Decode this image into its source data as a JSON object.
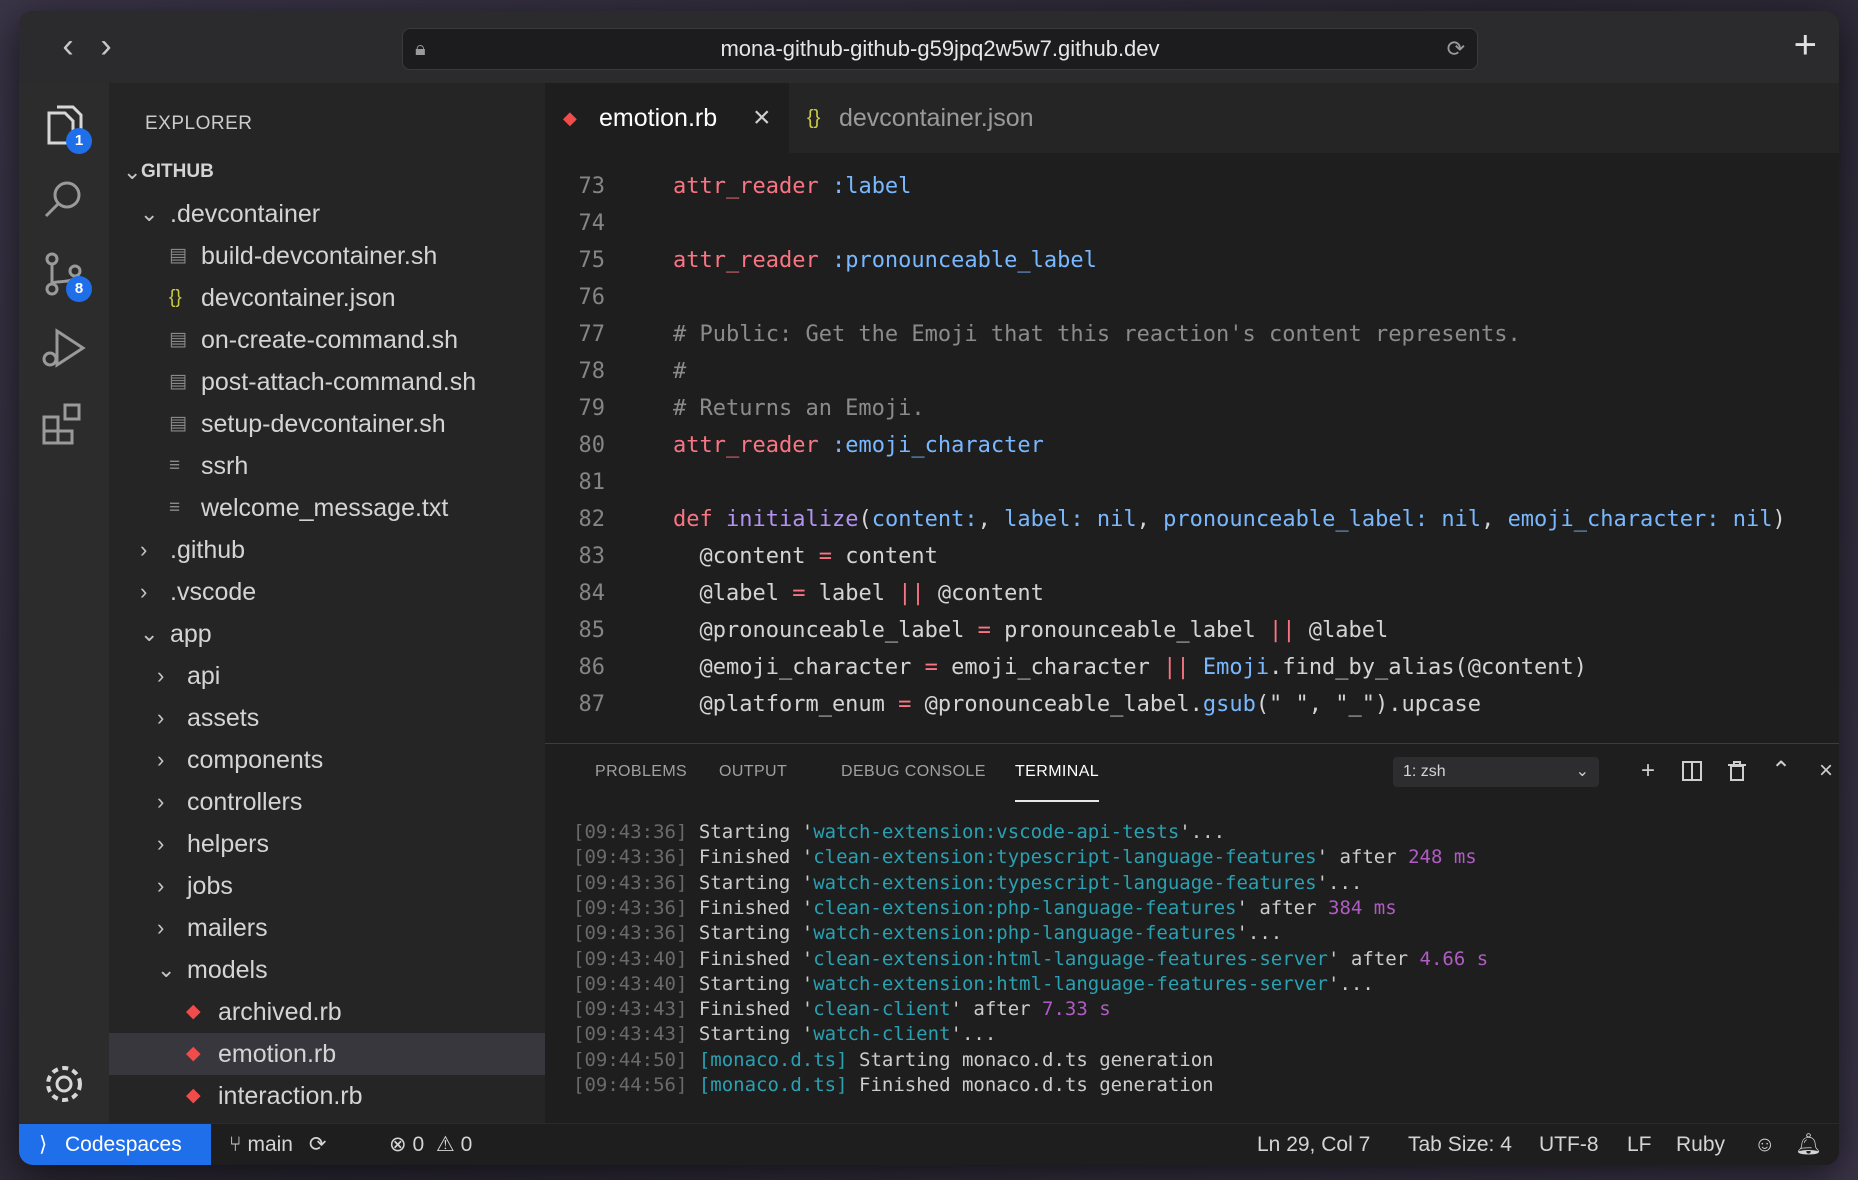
{
  "browser": {
    "url": "mona-github-github-g59jpq2w5w7.github.dev",
    "back": "‹",
    "forward": "›",
    "new_tab": "+"
  },
  "activity_bar": {
    "explorer_badge": "1",
    "scm_badge": "8"
  },
  "sidebar": {
    "title": "EXPLORER",
    "items": [
      {
        "label": "GITHUB",
        "chev": "⌄",
        "icon": ""
      },
      {
        "label": ".devcontainer",
        "chev": "⌄",
        "icon": ""
      },
      {
        "label": "build-devcontainer.sh",
        "chev": "",
        "icon": "▤"
      },
      {
        "label": "devcontainer.json",
        "chev": "",
        "icon": "{}"
      },
      {
        "label": "on-create-command.sh",
        "chev": "",
        "icon": "▤"
      },
      {
        "label": "post-attach-command.sh",
        "chev": "",
        "icon": "▤"
      },
      {
        "label": "setup-devcontainer.sh",
        "chev": "",
        "icon": "▤"
      },
      {
        "label": "ssrh",
        "chev": "",
        "icon": "≡"
      },
      {
        "label": "welcome_message.txt",
        "chev": "",
        "icon": "≡"
      },
      {
        "label": ".github",
        "chev": "›",
        "icon": ""
      },
      {
        "label": ".vscode",
        "chev": "›",
        "icon": ""
      },
      {
        "label": "app",
        "chev": "⌄",
        "icon": ""
      },
      {
        "label": "api",
        "chev": "›",
        "icon": ""
      },
      {
        "label": "assets",
        "chev": "›",
        "icon": ""
      },
      {
        "label": "components",
        "chev": "›",
        "icon": ""
      },
      {
        "label": "controllers",
        "chev": "›",
        "icon": ""
      },
      {
        "label": "helpers",
        "chev": "›",
        "icon": ""
      },
      {
        "label": "jobs",
        "chev": "›",
        "icon": ""
      },
      {
        "label": "mailers",
        "chev": "›",
        "icon": ""
      },
      {
        "label": "models",
        "chev": "⌄",
        "icon": ""
      },
      {
        "label": "archived.rb",
        "chev": "",
        "icon": "◆"
      },
      {
        "label": "emotion.rb",
        "chev": "",
        "icon": "◆"
      },
      {
        "label": "interaction.rb",
        "chev": "",
        "icon": "◆"
      }
    ]
  },
  "editor": {
    "tabs": [
      {
        "label": "emotion.rb",
        "icon": "◆",
        "close": "×"
      },
      {
        "label": "devcontainer.json",
        "icon": "{}"
      }
    ],
    "lines": [
      {
        "n": "73",
        "t": "attr_reader :label"
      },
      {
        "n": "74",
        "t": ""
      },
      {
        "n": "75",
        "t": "attr_reader :pronounceable_label"
      },
      {
        "n": "76",
        "t": ""
      },
      {
        "n": "77",
        "t": "# Public: Get the Emoji that this reaction's content represents."
      },
      {
        "n": "78",
        "t": "#"
      },
      {
        "n": "79",
        "t": "# Returns an Emoji."
      },
      {
        "n": "80",
        "t": "attr_reader :emoji_character"
      },
      {
        "n": "81",
        "t": ""
      },
      {
        "n": "82",
        "t": "def initialize(content:, label: nil, pronounceable_label: nil, emoji_character: nil)"
      },
      {
        "n": "83",
        "t": "  @content = content"
      },
      {
        "n": "84",
        "t": "  @label = label || @content"
      },
      {
        "n": "85",
        "t": "  @pronounceable_label = pronounceable_label || @label"
      },
      {
        "n": "86",
        "t": "  @emoji_character = emoji_character || Emoji.find_by_alias(@content)"
      },
      {
        "n": "87",
        "t": "  @platform_enum = @pronounceable_label.gsub(\" \", \"_\").upcase"
      }
    ]
  },
  "panel": {
    "tabs": [
      "PROBLEMS",
      "OUTPUT",
      "DEBUG CONSOLE",
      "TERMINAL"
    ],
    "terminal_select": "1: zsh",
    "lines": [
      {
        "time": "[09:43:36]",
        "pre": " Starting '",
        "task": "watch-extension:vscode-api-tests",
        "post": "'...",
        "dur": ""
      },
      {
        "time": "[09:43:36]",
        "pre": " Finished '",
        "task": "clean-extension:typescript-language-features",
        "post": "' after ",
        "dur": "248 ms"
      },
      {
        "time": "[09:43:36]",
        "pre": " Starting '",
        "task": "watch-extension:typescript-language-features",
        "post": "'...",
        "dur": ""
      },
      {
        "time": "[09:43:36]",
        "pre": " Finished '",
        "task": "clean-extension:php-language-features",
        "post": "' after ",
        "dur": "384 ms"
      },
      {
        "time": "[09:43:36]",
        "pre": " Starting '",
        "task": "watch-extension:php-language-features",
        "post": "'...",
        "dur": ""
      },
      {
        "time": "[09:43:40]",
        "pre": " Finished '",
        "task": "clean-extension:html-language-features-server",
        "post": "' after ",
        "dur": "4.66 s"
      },
      {
        "time": "[09:43:40]",
        "pre": " Starting '",
        "task": "watch-extension:html-language-features-server",
        "post": "'...",
        "dur": ""
      },
      {
        "time": "[09:43:43]",
        "pre": " Finished '",
        "task": "clean-client",
        "post": "' after ",
        "dur": "7.33 s"
      },
      {
        "time": "[09:43:43]",
        "pre": " Starting '",
        "task": "watch-client",
        "post": "'...",
        "dur": ""
      },
      {
        "time": "[09:44:50]",
        "pre": " ",
        "task": "[monaco.d.ts]",
        "post": " Starting monaco.d.ts generation",
        "dur": ""
      },
      {
        "time": "[09:44:56]",
        "pre": " ",
        "task": "[monaco.d.ts]",
        "post": " Finished monaco.d.ts generation",
        "dur": ""
      }
    ]
  },
  "status": {
    "codespaces": "Codespaces",
    "branch": "main",
    "errors": "0",
    "warnings": "0",
    "position": "Ln 29, Col 7",
    "tab_size": "Tab Size: 4",
    "encoding": "UTF-8",
    "eol": "LF",
    "language": "Ruby"
  },
  "colors": {
    "accent": "#1f6feb",
    "ruby_icon": "#f14c4c",
    "json_icon": "#cbcb41"
  }
}
